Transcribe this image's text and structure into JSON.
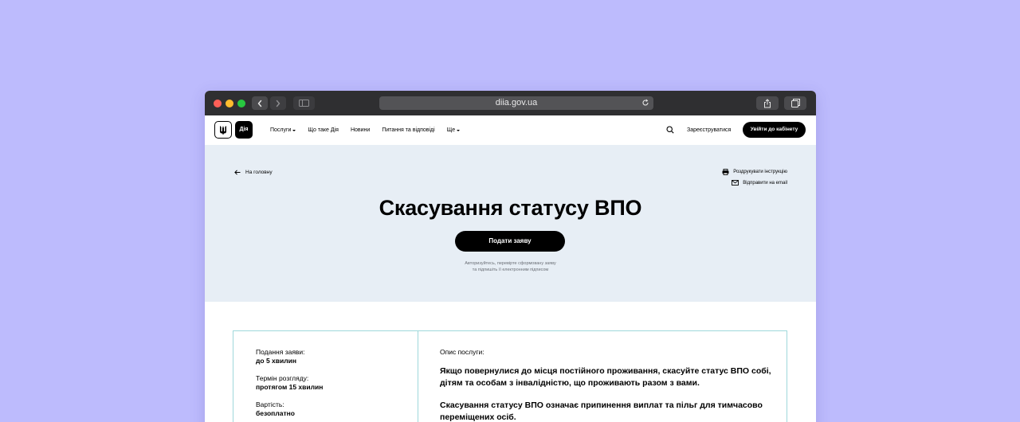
{
  "browser": {
    "url": "diia.gov.ua"
  },
  "header": {
    "logo_text": "Дія",
    "nav": [
      {
        "label": "Послуги",
        "has_dropdown": true
      },
      {
        "label": "Що таке Дія",
        "has_dropdown": false
      },
      {
        "label": "Новини",
        "has_dropdown": false
      },
      {
        "label": "Питання та відповіді",
        "has_dropdown": false
      },
      {
        "label": "Ще",
        "has_dropdown": true
      }
    ],
    "register_label": "Зареєструватися",
    "login_label": "Увійти до кабінету"
  },
  "hero": {
    "back_label": "На головну",
    "print_label": "Роздрукувати інструкцію",
    "email_label": "Відправити на email",
    "title": "Скасування статусу ВПО",
    "apply_label": "Подати заяву",
    "hint_line1": "Авторизуйтесь, перевірте сформовану заяву",
    "hint_line2": "та підпишіть її електронним підписом"
  },
  "details": {
    "facts": [
      {
        "label": "Подання заяви:",
        "value": "до 5 хвилин"
      },
      {
        "label": "Термін розгляду:",
        "value": "протягом 15 хвилин"
      },
      {
        "label": "Вартість:",
        "value": "безоплатно"
      }
    ],
    "description_label": "Опис послуги:",
    "paragraphs": [
      "Якщо повернулися до місця постійного проживання, скасуйте статус ВПО собі, дітям та особам з інвалідністю, що проживають разом з вами.",
      "Скасування статусу ВПО означає припинення виплат та пільг для тимчасово переміщених осіб."
    ]
  },
  "colors": {
    "page_background": "#bdbbfd",
    "hero_background": "#e7eef5",
    "card_border": "#9fd8db",
    "primary_button": "#000000"
  }
}
